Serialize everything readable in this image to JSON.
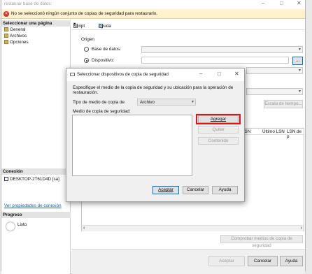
{
  "window": {
    "title": "restaurar base de datos:"
  },
  "warning": {
    "text": "No se seleccionó ningún conjunto de copias de seguridad para restaurarlo."
  },
  "left": {
    "select_page_header": "Seleccionar una página",
    "pages": [
      "General",
      "Archivos",
      "Opciones"
    ],
    "connection_header": "Conexión",
    "connection_server": "DESKTOP-2T61D4D [sa]",
    "connection_link": "Ver propiedades de conexión",
    "progress_header": "Progreso",
    "progress_status": "Listo"
  },
  "toolbar": {
    "script": "Script",
    "help": "Ayuda"
  },
  "source": {
    "group_label": "Origen",
    "database_radio": "Base de datos:",
    "device_radio": "Dispositivo:",
    "browse_button": "...",
    "selected": "device"
  },
  "timeline_button": "Escala de tiempo...",
  "backup_grid_columns": [
    "LSN",
    "Último LSN",
    "LSN de p"
  ],
  "verify_button": "Comprobar medios de copia de seguridad",
  "footer": {
    "ok": "Aceptar",
    "cancel": "Cancelar",
    "help": "Ayuda"
  },
  "dialog": {
    "title": "Seleccionar dispositivos de copia de seguridad",
    "instruction": "Especifique el medio de la copia de seguridad y su ubicación para la operación de restauración.",
    "media_type_label": "Tipo de medio de copia de",
    "media_type_value": "Archivo",
    "media_list_label": "Medio de copia de seguridad:",
    "add_button": "Agregar",
    "remove_button": "Quitar",
    "contents_button": "Contenido",
    "ok_button": "Aceptar",
    "cancel_button": "Cancelar",
    "help_button": "Ayuda"
  },
  "colors": {
    "highlight": "#e0151c",
    "accent": "#0078d7",
    "warning_bg": "#fff2cc"
  }
}
